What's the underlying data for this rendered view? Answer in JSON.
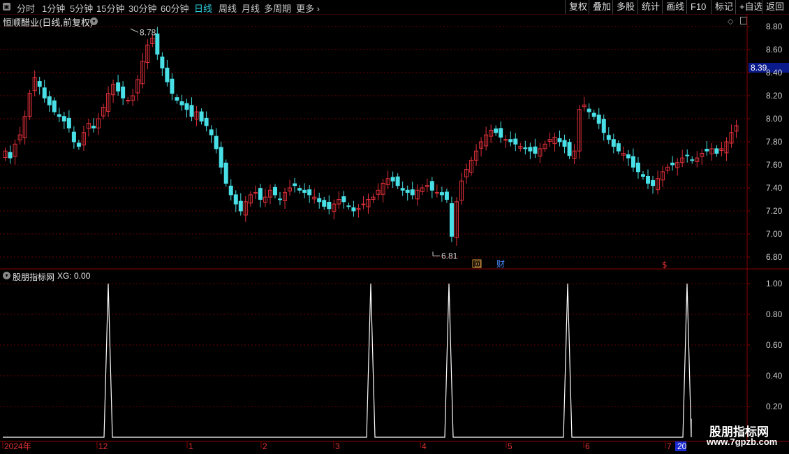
{
  "toolbar": {
    "periods": [
      {
        "label": "分时",
        "active": false
      },
      {
        "label": "1分钟",
        "active": false
      },
      {
        "label": "5分钟",
        "active": false
      },
      {
        "label": "15分钟",
        "active": false
      },
      {
        "label": "30分钟",
        "active": false
      },
      {
        "label": "60分钟",
        "active": false
      },
      {
        "label": "日线",
        "active": true
      },
      {
        "label": "周线",
        "active": false
      },
      {
        "label": "月线",
        "active": false
      },
      {
        "label": "多周期",
        "active": false
      },
      {
        "label": "更多",
        "active": false
      }
    ],
    "right_buttons": [
      "复权",
      "叠加",
      "多股",
      "统计",
      "画线",
      "F10",
      "标记",
      "+自选",
      "返回"
    ]
  },
  "main_chart": {
    "title": "恒顺醋业(日线,前复权)",
    "y_ticks": [
      "8.80",
      "8.60",
      "8.40",
      "8.20",
      "8.00",
      "7.80",
      "7.60",
      "7.40",
      "7.20",
      "7.00",
      "6.80"
    ],
    "current_price": "8.39",
    "high_label": "8.78",
    "low_label": "6.81",
    "markers": {
      "hui": "回",
      "cai": "财",
      "dollar": "$"
    }
  },
  "indicator": {
    "title": "股朋指标网",
    "value_text": "XG: 0.00",
    "y_ticks": [
      "1.00",
      "0.80",
      "0.60",
      "0.40",
      "0.20"
    ]
  },
  "x_axis": {
    "labels": [
      "2024年",
      "12",
      "1",
      "2",
      "3",
      "4",
      "5",
      "6",
      "7",
      "20"
    ]
  },
  "watermark": {
    "title": "股朋指标网",
    "url": "www.7gpzb.com"
  },
  "colors": {
    "up": "#e0303a",
    "down": "#48e0e6",
    "grid": "#6a0000",
    "signal": "#ffffff",
    "active": "#2fd2e0"
  },
  "chart_data": {
    "type": "candlestick",
    "ylim": [
      6.75,
      8.85
    ],
    "high": 8.78,
    "low": 6.81,
    "last_close": 8.39,
    "indicator_series": {
      "name": "XG",
      "ylim": [
        0,
        1.05
      ],
      "peak_value": 1.0,
      "baseline": 0.0
    }
  }
}
